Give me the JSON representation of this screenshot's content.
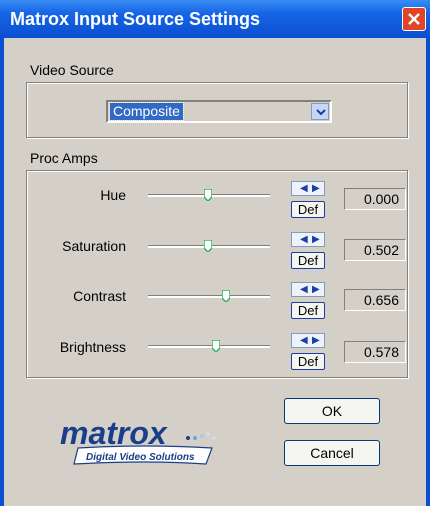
{
  "window": {
    "title": "Matrox Input Source Settings",
    "close_glyph": "close-x-icon"
  },
  "video_source": {
    "label": "Video Source",
    "selected": "Composite"
  },
  "proc_amps": {
    "label": "Proc Amps",
    "rows": [
      {
        "label": "Hue",
        "value": "0.000",
        "def_label": "Def",
        "slider_fraction": 0.5
      },
      {
        "label": "Saturation",
        "value": "0.502",
        "def_label": "Def",
        "slider_fraction": 0.5
      },
      {
        "label": "Contrast",
        "value": "0.656",
        "def_label": "Def",
        "slider_fraction": 0.62
      },
      {
        "label": "Brightness",
        "value": "0.578",
        "def_label": "Def",
        "slider_fraction": 0.56
      }
    ]
  },
  "buttons": {
    "ok": "OK",
    "cancel": "Cancel"
  },
  "logo": {
    "brand": "matrox",
    "tagline": "Digital Video Solutions"
  },
  "colors": {
    "titlebar": "#0a4fd0",
    "dialog": "#d4d0c8",
    "selection": "#316ac5",
    "logo_blue": "#1a3f8a",
    "thumb": "#2fb15a"
  }
}
